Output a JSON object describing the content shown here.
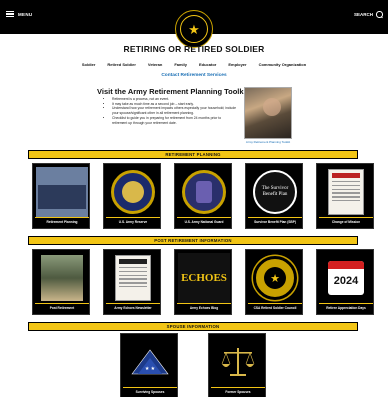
{
  "header": {
    "menu_label": "MENU",
    "search_label": "SEARCH",
    "logo_alt": "U.S. ARMY"
  },
  "page": {
    "title": "RETIRING OR RETIRED SOLDIER",
    "contact_link": "Contact Retirement Services"
  },
  "subnav": [
    "Soldier",
    "Retired Soldier",
    "Veteran",
    "Family",
    "Educator",
    "Employer",
    "Community Organization"
  ],
  "toolkit": {
    "title": "Visit the Army Retirement Planning Toolkit:",
    "items": [
      "Retirement is a process, not an event.",
      "It may take as much time as a second job – start early.",
      "Understand how your retirement impacts others especially your household; include your spouse/significant other in all retirement planning.",
      "Checklist to guide you in preparing for retirement from 24 months prior to retirement up through your retirement date."
    ],
    "caption": "Army Retirement Planning Toolkit"
  },
  "sections": {
    "retirement_planning": "RETIREMENT PLANNING",
    "post_retirement": "POST RETIREMENT INFORMATION",
    "spouse": "SPOUSE INFORMATION"
  },
  "cards": {
    "retirement_planning": [
      "Retirement Planning",
      "U.S. Army Reserve",
      "U.S. Army National Guard",
      "Survivor Benefit Plan (SBP)",
      "Change of Mission"
    ],
    "post_retirement": [
      "Post Retirement",
      "Army Echoes Newsletter",
      "Army Echoes Blog",
      "CSA Retired Soldier Council",
      "Retiree Appreciation Days"
    ],
    "spouse": [
      "Surviving Spouses",
      "Former Spouses"
    ]
  },
  "card_art": {
    "echoes_text": "ECHOES",
    "year_2024": "2024",
    "sbp_text": "The Survivor Benefit Plan"
  },
  "colors": {
    "accent": "#f2c515",
    "link": "#1a6fb5",
    "header_bg": "#000000"
  }
}
